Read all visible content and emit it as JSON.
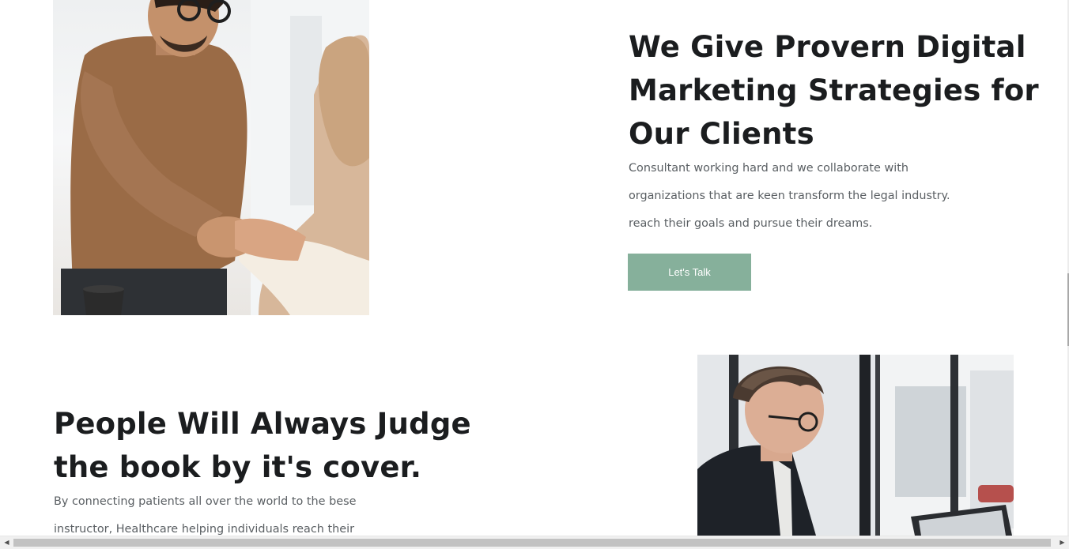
{
  "section_one": {
    "heading_lines": [
      "We Give Provern Digital",
      "Marketing Strategies for",
      "Our Clients"
    ],
    "paragraph_lines": [
      "Consultant working hard and we collaborate with",
      "organizations that are keen transform the legal industry.",
      "reach their goals and pursue their dreams."
    ],
    "cta_label": "Let's Talk",
    "image": "photo-handshake-meeting"
  },
  "section_two": {
    "heading_lines": [
      "People Will Always Judge",
      "the book by it's cover."
    ],
    "paragraph_lines": [
      "By connecting patients all over the world to the bese",
      "instructor, Healthcare helping individuals reach their"
    ],
    "image": "photo-man-working-laptop"
  },
  "colors": {
    "accent": "#86b09b",
    "heading": "#1b1d1f",
    "body_text": "#5a5f63"
  },
  "scrollbar": {
    "left_arrow": "◀",
    "right_arrow": "▶"
  }
}
